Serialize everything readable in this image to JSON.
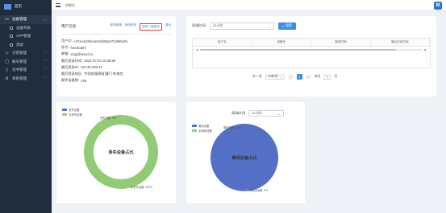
{
  "sidebar": {
    "home": "首页",
    "items": [
      {
        "label": "设备管理",
        "icon": "monitor-icon",
        "expanded": true
      },
      {
        "label": "设备列表",
        "icon": "list-icon",
        "sub": true
      },
      {
        "label": "APP管理",
        "icon": "app-icon",
        "sub": true
      },
      {
        "label": "测试",
        "icon": "doc-icon",
        "sub": true
      },
      {
        "label": "分组管理",
        "icon": "group-icon"
      },
      {
        "label": "账号管理",
        "icon": "user-icon"
      },
      {
        "label": "证书管理",
        "icon": "cert-icon"
      },
      {
        "label": "系统管理",
        "icon": "settings-icon"
      }
    ]
  },
  "topbar": {
    "breadcrumb": "控制台"
  },
  "user_card": {
    "title": "用户信息",
    "links": [
      "修改邮箱",
      "修改密码",
      "修改二级密码",
      "退出"
    ],
    "fields": [
      {
        "label": "用户ID:",
        "value": "c47ac4d4f4e4e91fb68a57c2b65d21"
      },
      {
        "label": "账号:",
        "value": "heedcashi"
      },
      {
        "label": "邮箱:",
        "value": "xing@heied.cn"
      },
      {
        "label": "最后登录时间:",
        "value": "2024-07-23 10:48:55"
      },
      {
        "label": "最后登录IP:",
        "value": "120.36.206.44"
      },
      {
        "label": "最后登录地区:",
        "value": "中国|0|福建省|厦门市|电信"
      },
      {
        "label": "剩余设备数:",
        "value": "198"
      }
    ]
  },
  "search_card": {
    "label": "离线时间",
    "select_value": "12小时",
    "button": "搜索",
    "columns": [
      "用户名",
      "设备号",
      "离线时间",
      "最后在线时间"
    ],
    "pager": {
      "total": "共 1 条",
      "page_size": "10条/页",
      "prev": "<",
      "current": "1",
      "next": ">",
      "goto_label": "前往",
      "goto_value": "1",
      "goto_suffix": "页"
    }
  },
  "chart_data": [
    {
      "type": "pie",
      "title": "丢失设备占比",
      "series": [
        {
          "name": "丢失设备",
          "value": 0,
          "color": "#5470c6",
          "label": "丢失设备: 0%"
        },
        {
          "name": "未丢失设备",
          "value": 100,
          "color": "#91cc75",
          "label": "未丢失设备: 100%"
        }
      ],
      "legend": "top-left"
    },
    {
      "type": "pie",
      "title": "离线设备占比",
      "filter_label": "离线时间",
      "filter_value": "12小时",
      "series": [
        {
          "name": "离线设备",
          "value": 100,
          "color": "#5470c6",
          "label": "离线设备: 100%"
        },
        {
          "name": "未离线设备",
          "value": 0,
          "color": "#91cc75",
          "label": "未离线设备: 0%"
        }
      ],
      "legend": "top-left"
    }
  ]
}
